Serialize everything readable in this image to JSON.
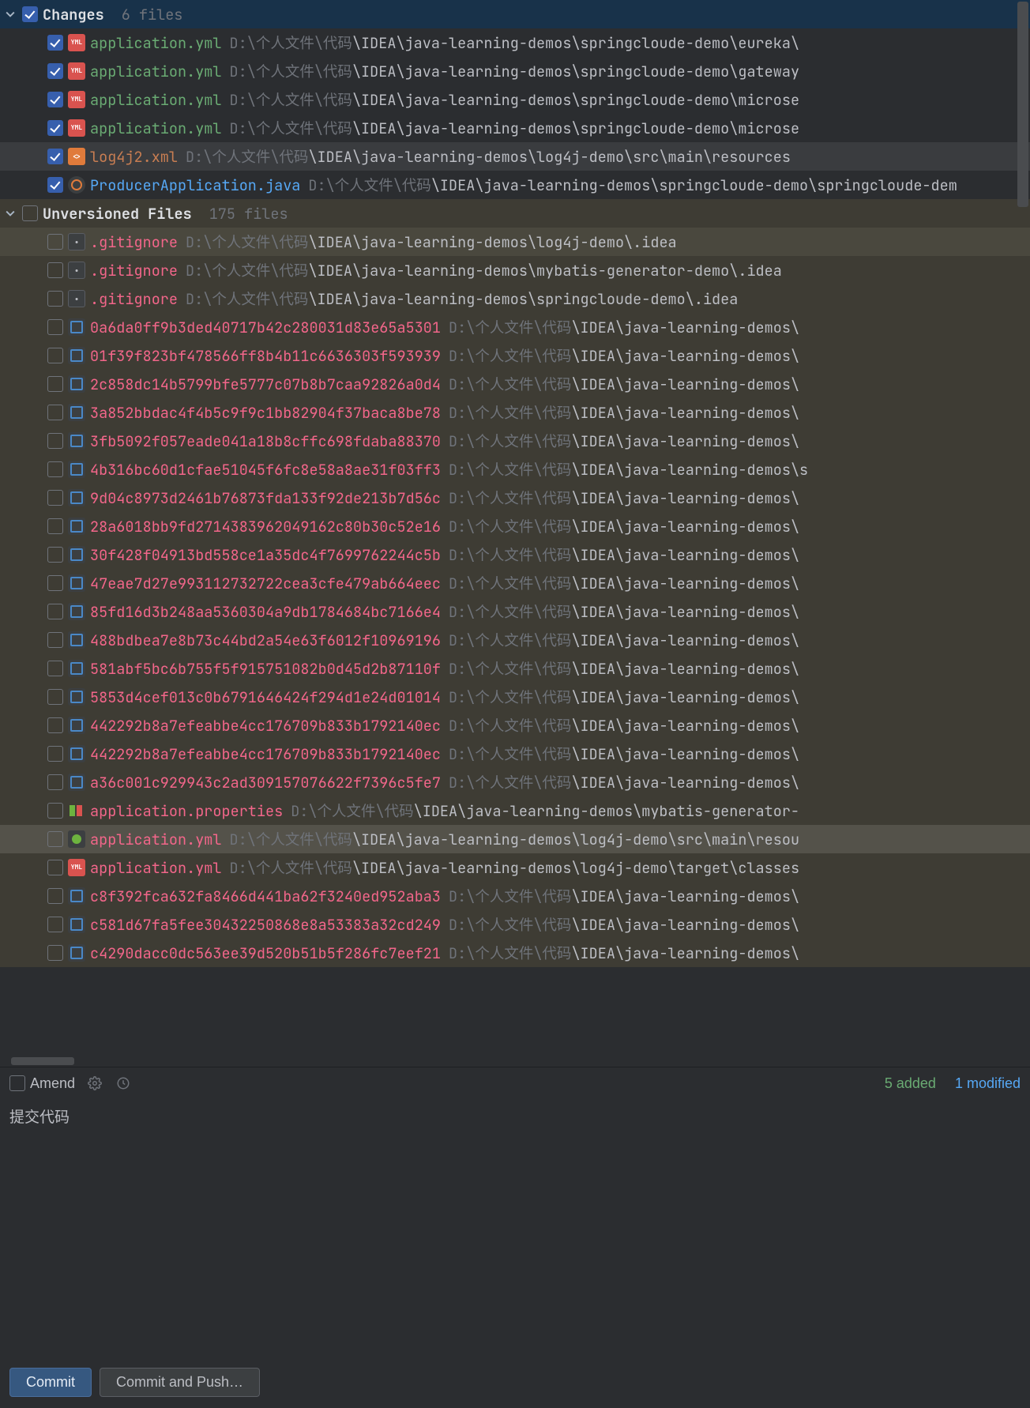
{
  "sections": {
    "changes": {
      "title": "Changes",
      "count": "6 files"
    },
    "unversioned": {
      "title": "Unversioned Files",
      "count": "175 files"
    }
  },
  "changes_items": [
    {
      "name": "application.yml",
      "color": "green",
      "icon": "yml",
      "path_pre": "D:\\",
      "path_mid": "个人文件\\代码",
      "path_post": "\\IDEA\\java-learning-demos\\springcloude-demo\\eureka\\"
    },
    {
      "name": "application.yml",
      "color": "green",
      "icon": "yml",
      "path_pre": "D:\\",
      "path_mid": "个人文件\\代码",
      "path_post": "\\IDEA\\java-learning-demos\\springcloude-demo\\gateway"
    },
    {
      "name": "application.yml",
      "color": "green",
      "icon": "yml",
      "path_pre": "D:\\",
      "path_mid": "个人文件\\代码",
      "path_post": "\\IDEA\\java-learning-demos\\springcloude-demo\\microse"
    },
    {
      "name": "application.yml",
      "color": "green",
      "icon": "yml",
      "path_pre": "D:\\",
      "path_mid": "个人文件\\代码",
      "path_post": "\\IDEA\\java-learning-demos\\springcloude-demo\\microse"
    },
    {
      "name": "log4j2.xml",
      "color": "orange",
      "icon": "xml",
      "sel": true,
      "path_pre": "D:\\",
      "path_mid": "个人文件\\代码",
      "path_post": "\\IDEA\\java-learning-demos\\log4j-demo\\src\\main\\resources"
    },
    {
      "name": "ProducerApplication.java",
      "color": "blue",
      "icon": "java",
      "path_pre": "D:\\",
      "path_mid": "个人文件\\代码",
      "path_post": "\\IDEA\\java-learning-demos\\springcloude-demo\\springcloude-dem"
    }
  ],
  "unversioned_items": [
    {
      "name": ".gitignore",
      "color": "red",
      "icon": "gitig",
      "sel": 1,
      "path_pre": "D:\\",
      "path_mid": "个人文件\\代码",
      "path_post": "\\IDEA\\java-learning-demos\\log4j-demo\\.idea"
    },
    {
      "name": ".gitignore",
      "color": "red",
      "icon": "gitig",
      "path_pre": "D:\\",
      "path_mid": "个人文件\\代码",
      "path_post": "\\IDEA\\java-learning-demos\\mybatis-generator-demo\\.idea"
    },
    {
      "name": ".gitignore",
      "color": "red",
      "icon": "gitig",
      "path_pre": "D:\\",
      "path_mid": "个人文件\\代码",
      "path_post": "\\IDEA\\java-learning-demos\\springcloude-demo\\.idea"
    },
    {
      "name": "0a6da0ff9b3ded40717b42c280031d83e65a5301",
      "color": "red",
      "icon": "hash",
      "path_pre": "D:\\",
      "path_mid": "个人文件\\代码",
      "path_post": "\\IDEA\\java-learning-demos\\"
    },
    {
      "name": "01f39f823bf478566ff8b4b11c6636303f593939",
      "color": "red",
      "icon": "hash",
      "path_pre": "D:\\",
      "path_mid": "个人文件\\代码",
      "path_post": "\\IDEA\\java-learning-demos\\"
    },
    {
      "name": "2c858dc14b5799bfe5777c07b8b7caa92826a0d4",
      "color": "red",
      "icon": "hash",
      "path_pre": "D:\\",
      "path_mid": "个人文件\\代码",
      "path_post": "\\IDEA\\java-learning-demos\\"
    },
    {
      "name": "3a852bbdac4f4b5c9f9c1bb82904f37baca8be78",
      "color": "red",
      "icon": "hash",
      "path_pre": "D:\\",
      "path_mid": "个人文件\\代码",
      "path_post": "\\IDEA\\java-learning-demos\\"
    },
    {
      "name": "3fb5092f057eade041a18b8cffc698fdaba88370",
      "color": "red",
      "icon": "hash",
      "path_pre": "D:\\",
      "path_mid": "个人文件\\代码",
      "path_post": "\\IDEA\\java-learning-demos\\"
    },
    {
      "name": "4b316bc60d1cfae51045f6fc8e58a8ae31f03ff3",
      "color": "red",
      "icon": "hash",
      "path_pre": "D:\\",
      "path_mid": "个人文件\\代码",
      "path_post": "\\IDEA\\java-learning-demos\\s"
    },
    {
      "name": "9d04c8973d2461b76873fda133f92de213b7d56c",
      "color": "red",
      "icon": "hash",
      "path_pre": "D:\\",
      "path_mid": "个人文件\\代码",
      "path_post": "\\IDEA\\java-learning-demos\\"
    },
    {
      "name": "28a6018bb9fd2714383962049162c80b30c52e16",
      "color": "red",
      "icon": "hash",
      "path_pre": "D:\\",
      "path_mid": "个人文件\\代码",
      "path_post": "\\IDEA\\java-learning-demos\\"
    },
    {
      "name": "30f428f04913bd558ce1a35dc4f7699762244c5b",
      "color": "red",
      "icon": "hash",
      "path_pre": "D:\\",
      "path_mid": "个人文件\\代码",
      "path_post": "\\IDEA\\java-learning-demos\\"
    },
    {
      "name": "47eae7d27e993112732722cea3cfe479ab664eec",
      "color": "red",
      "icon": "hash",
      "path_pre": "D:\\",
      "path_mid": "个人文件\\代码",
      "path_post": "\\IDEA\\java-learning-demos\\"
    },
    {
      "name": "85fd16d3b248aa5360304a9db1784684bc7166e4",
      "color": "red",
      "icon": "hash",
      "path_pre": "D:\\",
      "path_mid": "个人文件\\代码",
      "path_post": "\\IDEA\\java-learning-demos\\"
    },
    {
      "name": "488bdbea7e8b73c44bd2a54e63f6012f10969196",
      "color": "red",
      "icon": "hash",
      "path_pre": "D:\\",
      "path_mid": "个人文件\\代码",
      "path_post": "\\IDEA\\java-learning-demos\\"
    },
    {
      "name": "581abf5bc6b755f5f915751082b0d45d2b87110f",
      "color": "red",
      "icon": "hash",
      "path_pre": "D:\\",
      "path_mid": "个人文件\\代码",
      "path_post": "\\IDEA\\java-learning-demos\\"
    },
    {
      "name": "5853d4cef013c0b6791646424f294d1e24d01014",
      "color": "red",
      "icon": "hash",
      "path_pre": "D:\\",
      "path_mid": "个人文件\\代码",
      "path_post": "\\IDEA\\java-learning-demos\\"
    },
    {
      "name": "442292b8a7efeabbe4cc176709b833b1792140ec",
      "color": "red",
      "icon": "hash",
      "path_pre": "D:\\",
      "path_mid": "个人文件\\代码",
      "path_post": "\\IDEA\\java-learning-demos\\"
    },
    {
      "name": "442292b8a7efeabbe4cc176709b833b1792140ec",
      "color": "red",
      "icon": "hash",
      "path_pre": "D:\\",
      "path_mid": "个人文件\\代码",
      "path_post": "\\IDEA\\java-learning-demos\\"
    },
    {
      "name": "a36c001c929943c2ad309157076622f7396c5fe7",
      "color": "red",
      "icon": "hash",
      "path_pre": "D:\\",
      "path_mid": "个人文件\\代码",
      "path_post": "\\IDEA\\java-learning-demos\\"
    },
    {
      "name": "application.properties",
      "color": "red",
      "icon": "prop",
      "path_pre": "D:\\",
      "path_mid": "个人文件\\代码",
      "path_post": "\\IDEA\\java-learning-demos\\mybatis-generator-"
    },
    {
      "name": "application.yml",
      "color": "red",
      "icon": "spring",
      "sel": 2,
      "path_pre": "D:\\",
      "path_mid": "个人文件\\代码",
      "path_post": "\\IDEA\\java-learning-demos\\log4j-demo\\src\\main\\resou"
    },
    {
      "name": "application.yml",
      "color": "red",
      "icon": "yml",
      "path_pre": "D:\\",
      "path_mid": "个人文件\\代码",
      "path_post": "\\IDEA\\java-learning-demos\\log4j-demo\\target\\classes"
    },
    {
      "name": "c8f392fca632fa8466d441ba62f3240ed952aba3",
      "color": "red",
      "icon": "hash",
      "path_pre": "D:\\",
      "path_mid": "个人文件\\代码",
      "path_post": "\\IDEA\\java-learning-demos\\"
    },
    {
      "name": "c581d67fa5fee30432250868e8a53383a32cd249",
      "color": "red",
      "icon": "hash",
      "path_pre": "D:\\",
      "path_mid": "个人文件\\代码",
      "path_post": "\\IDEA\\java-learning-demos\\"
    },
    {
      "name": "c4290dacc0dc563ee39d520b51b5f286fc7eef21",
      "color": "red",
      "icon": "hash",
      "path_pre": "D:\\",
      "path_mid": "个人文件\\代码",
      "path_post": "\\IDEA\\java-learning-demos\\"
    }
  ],
  "footer": {
    "amend": "Amend",
    "added": "5 added",
    "modified": "1 modified",
    "message": "提交代码",
    "commit": "Commit",
    "commit_push": "Commit and Push…"
  }
}
